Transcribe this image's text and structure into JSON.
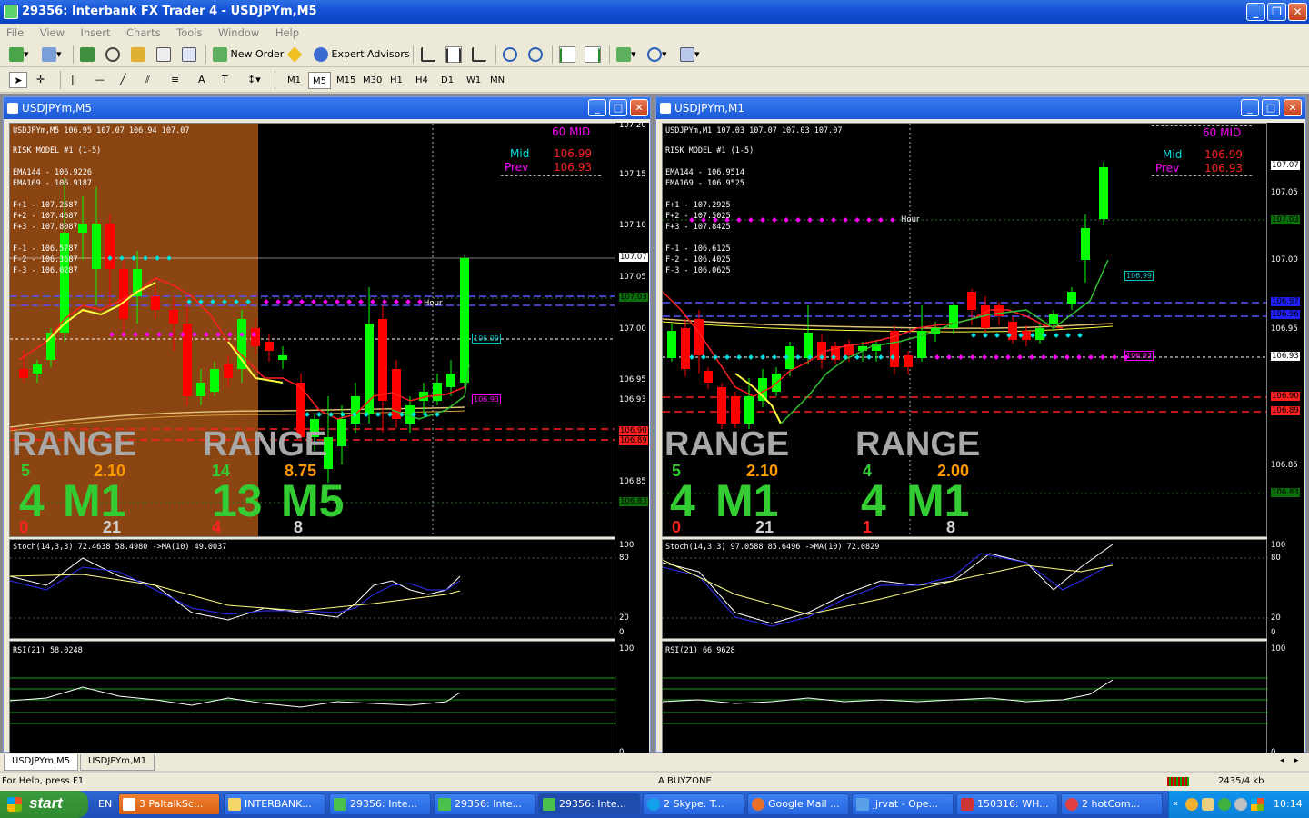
{
  "window": {
    "title": "29356: Interbank FX Trader 4 - USDJPYm,M5"
  },
  "menu": [
    "File",
    "View",
    "Insert",
    "Charts",
    "Tools",
    "Window",
    "Help"
  ],
  "toolbar": {
    "new_order": "New Order",
    "expert_advisors": "Expert Advisors"
  },
  "timeframes": [
    "M1",
    "M5",
    "M15",
    "M30",
    "H1",
    "H4",
    "D1",
    "W1",
    "MN"
  ],
  "selected_timeframe": "M5",
  "charts": [
    {
      "window_title": "USDJPYm,M5",
      "header": "USDJPYm,M5  106.95 107.07 106.94 107.07",
      "risk_model": "RISK MODEL #1 (1-5)",
      "ema": [
        "EMA144 - 106.9226",
        "EMA169 - 106.9187"
      ],
      "fib_up": [
        "F+1 - 107.2587",
        "F+2 - 107.4687",
        "F+3 - 107.8087"
      ],
      "fib_down": [
        "F-1 - 106.5787",
        "F-2 - 106.3687",
        "F-3 - 106.0287"
      ],
      "mid_box": {
        "title": "60 MID",
        "mid_label": "Mid",
        "mid_value": "106.99",
        "prev_label": "Prev",
        "prev_value": "106.93"
      },
      "hour_label": "Hour",
      "price_scale": [
        "107.20",
        "107.15",
        "107.10",
        "107.07",
        "107.05",
        "107.03",
        "107.00",
        "106.95",
        "106.93",
        "106.90",
        "106.89",
        "106.85",
        "106.83"
      ],
      "range_blocks": [
        {
          "word": "RANGE",
          "count": "5",
          "value": "2.10",
          "tf_count": "4",
          "tf": "M1",
          "down": "0",
          "total": "21"
        },
        {
          "word": "RANGE",
          "count": "14",
          "value": "8.75",
          "tf_count": "13",
          "tf": "M5",
          "down": "4",
          "total": "8"
        }
      ],
      "price_tags": [
        "106.99",
        "106.93"
      ],
      "stoch": {
        "label": "Stoch(14,3,3) 72.4638 58.4980  ->MA(10) 49.0037",
        "levels": [
          "100",
          "80",
          "20",
          "0"
        ]
      },
      "rsi": {
        "label": "RSI(21) 58.0248",
        "levels": [
          "100",
          "0"
        ]
      }
    },
    {
      "window_title": "USDJPYm,M1",
      "header": "USDJPYm,M1  107.03 107.07 107.03 107.07",
      "risk_model": "RISK MODEL #1 (1-5)",
      "ema": [
        "EMA144 - 106.9514",
        "EMA169 - 106.9525"
      ],
      "fib_up": [
        "F+1 - 107.2925",
        "F+2 - 107.5025",
        "F+3 - 107.8425"
      ],
      "fib_down": [
        "F-1 - 106.6125",
        "F-2 - 106.4025",
        "F-3 - 106.0625"
      ],
      "mid_box": {
        "title": "60 MID",
        "mid_label": "Mid",
        "mid_value": "106.99",
        "prev_label": "Prev",
        "prev_value": "106.93"
      },
      "hour_label": "Hour",
      "price_scale": [
        "107.07",
        "107.05",
        "107.03",
        "107.00",
        "106.97",
        "106.96",
        "106.95",
        "106.93",
        "106.90",
        "106.89",
        "106.85",
        "106.83"
      ],
      "range_blocks": [
        {
          "word": "RANGE",
          "count": "5",
          "value": "2.10",
          "tf_count": "4",
          "tf": "M1",
          "down": "0",
          "total": "21"
        },
        {
          "word": "RANGE",
          "count": "4",
          "value": "2.00",
          "tf_count": "4",
          "tf": "M1",
          "down": "1",
          "total": "8"
        }
      ],
      "price_tags": [
        "106.99",
        "106.93"
      ],
      "stoch": {
        "label": "Stoch(14,3,3) 97.0588 85.6496  ->MA(10) 72.0829",
        "levels": [
          "100",
          "80",
          "20",
          "0"
        ]
      },
      "rsi": {
        "label": "RSI(21) 66.9628",
        "levels": [
          "100",
          "0"
        ]
      }
    }
  ],
  "chart_tabs": [
    "USDJPYm,M5",
    "USDJPYm,M1"
  ],
  "status": {
    "help": "For Help, press F1",
    "profile": "A BUYZONE",
    "traffic": "2435/4 kb"
  },
  "taskbar": {
    "start": "start",
    "lang": "EN",
    "items": [
      "3 PaltalkSc...",
      "INTERBANK...",
      "29356: Inte...",
      "29356: Inte...",
      "29356: Inte...",
      "2 Skype. T...",
      "Google Mail ...",
      "jjrvat - Ope...",
      "150316: WH...",
      "2 hotCom..."
    ],
    "clock": "10:14"
  },
  "colors": {
    "bull": "#00ff00",
    "bear": "#ff0000",
    "range_gray": "#a0a0a0",
    "range_green": "#33cc33",
    "orange": "#ff9900",
    "mid_cyan": "#00e0e0",
    "prev_magenta": "#ff00ff"
  }
}
